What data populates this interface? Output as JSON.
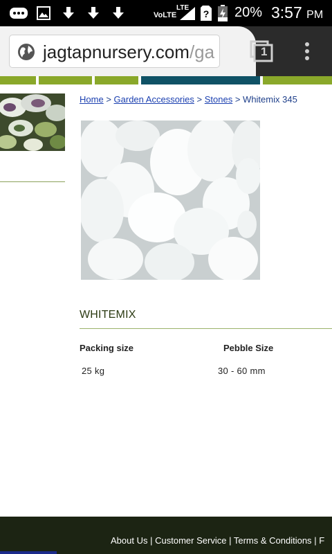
{
  "status_bar": {
    "network": "VoLTE",
    "signal_type": "LTE",
    "battery": "20%",
    "time": "3:57",
    "ampm": "PM",
    "icons": [
      "message-icon",
      "image-icon",
      "download-icon",
      "download-icon",
      "download-icon",
      "signal-icon",
      "sim-unknown-icon",
      "battery-icon"
    ]
  },
  "browser": {
    "url_host": "jagtapnursery.com",
    "url_path": "/ga",
    "tab_count": "1"
  },
  "colors": {
    "nav_green": "#8aa82a",
    "nav_teal": "#0f5266",
    "footer_bg": "#1c2413",
    "link_blue": "#1a3fb0"
  },
  "breadcrumb": {
    "items": [
      "Home",
      "Garden Accessories",
      "Stones"
    ],
    "separator": ">",
    "current": "Whitemix 345"
  },
  "product": {
    "image_alt": "White pebbles",
    "title": "WHITEMIX",
    "spec_headers": [
      "Packing size",
      "Pebble Size"
    ],
    "spec_values": [
      "25 kg",
      "30 - 60 mm"
    ]
  },
  "footer": {
    "links": [
      "About Us",
      "Customer Service",
      "Terms & Conditions",
      "F"
    ],
    "separator": "|"
  }
}
